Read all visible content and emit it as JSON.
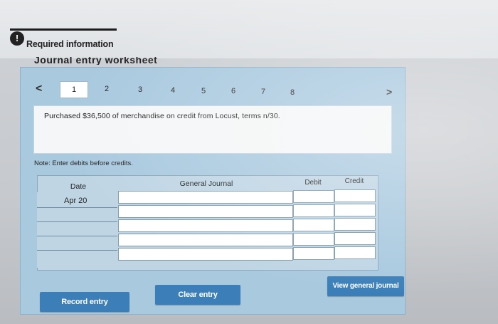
{
  "header": {
    "info_icon_glyph": "!",
    "required_label": "Required information",
    "worksheet_title": "Journal entry worksheet"
  },
  "nav": {
    "prev_glyph": "<",
    "next_glyph": ">",
    "steps": [
      "1",
      "2",
      "3",
      "4",
      "5",
      "6",
      "7",
      "8"
    ],
    "active_step": 1
  },
  "transaction": {
    "description": "Purchased $36,500 of merchandise on credit from Locust, terms n/30."
  },
  "note": "Note: Enter debits before credits.",
  "journal_table": {
    "headers": {
      "date": "Date",
      "general_journal": "General Journal",
      "debit": "Debit",
      "credit": "Credit"
    },
    "rows": [
      {
        "date": "Apr 20",
        "account": "",
        "debit": "",
        "credit": ""
      },
      {
        "date": "",
        "account": "",
        "debit": "",
        "credit": ""
      },
      {
        "date": "",
        "account": "",
        "debit": "",
        "credit": ""
      },
      {
        "date": "",
        "account": "",
        "debit": "",
        "credit": ""
      },
      {
        "date": "",
        "account": "",
        "debit": "",
        "credit": ""
      },
      {
        "date": "",
        "account": "",
        "debit": "",
        "credit": ""
      }
    ]
  },
  "buttons": {
    "record_entry": "Record entry",
    "clear_entry": "Clear entry",
    "view_general_journal": "View general journal"
  },
  "colors": {
    "panel_blue": "#a9c9df",
    "button_blue": "#3c7fb8"
  }
}
